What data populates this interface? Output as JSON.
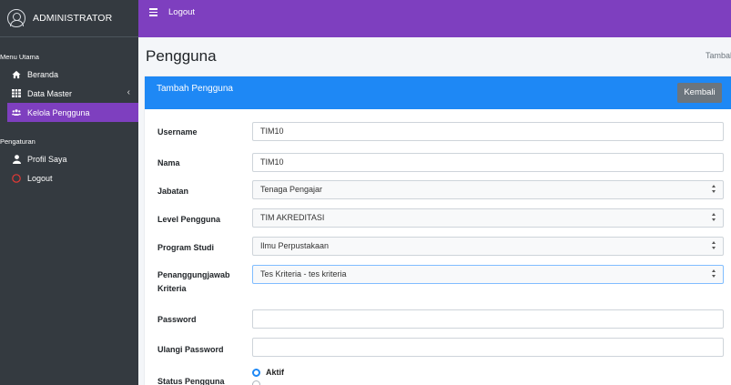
{
  "sidebar": {
    "user_name": "ADMINISTRATOR",
    "section_main": "Menu Utama",
    "items_main": [
      {
        "label": "Beranda",
        "icon": "home-icon"
      },
      {
        "label": "Data Master",
        "icon": "table-icon"
      },
      {
        "label": "Kelola Pengguna",
        "icon": "users-icon"
      }
    ],
    "section_settings": "Pengaturan",
    "items_settings": [
      {
        "label": "Profil Saya",
        "icon": "user-icon"
      },
      {
        "label": "Logout",
        "icon": "power-circle-icon"
      }
    ],
    "active_color": "#7e3fbf",
    "logout_icon_color": "#e53935"
  },
  "topbar": {
    "logout_label": "Logout",
    "color": "#7e3fbf"
  },
  "page": {
    "title": "Pengguna",
    "breadcrumb": "Tambah"
  },
  "card": {
    "header_title": "Tambah Pengguna",
    "back_button": "Kembali",
    "header_color": "#1e88f5"
  },
  "form": {
    "username": {
      "label": "Username",
      "value": "TIM10"
    },
    "nama": {
      "label": "Nama",
      "value": "TIM10"
    },
    "jabatan": {
      "label": "Jabatan",
      "value": "Tenaga Pengajar"
    },
    "level": {
      "label": "Level Pengguna",
      "value": "TIM AKREDITASI"
    },
    "prodi": {
      "label": "Program Studi",
      "value": "Ilmu Perpustakaan"
    },
    "kriteria": {
      "label_line1": "Penanggungjawab",
      "label_line2": "Kriteria",
      "value": "Tes Kriteria - tes kriteria"
    },
    "password": {
      "label": "Password",
      "value": ""
    },
    "ulangi_password": {
      "label": "Ulangi Password",
      "value": ""
    },
    "status": {
      "label": "Status Pengguna",
      "option_active": "Aktif"
    }
  }
}
